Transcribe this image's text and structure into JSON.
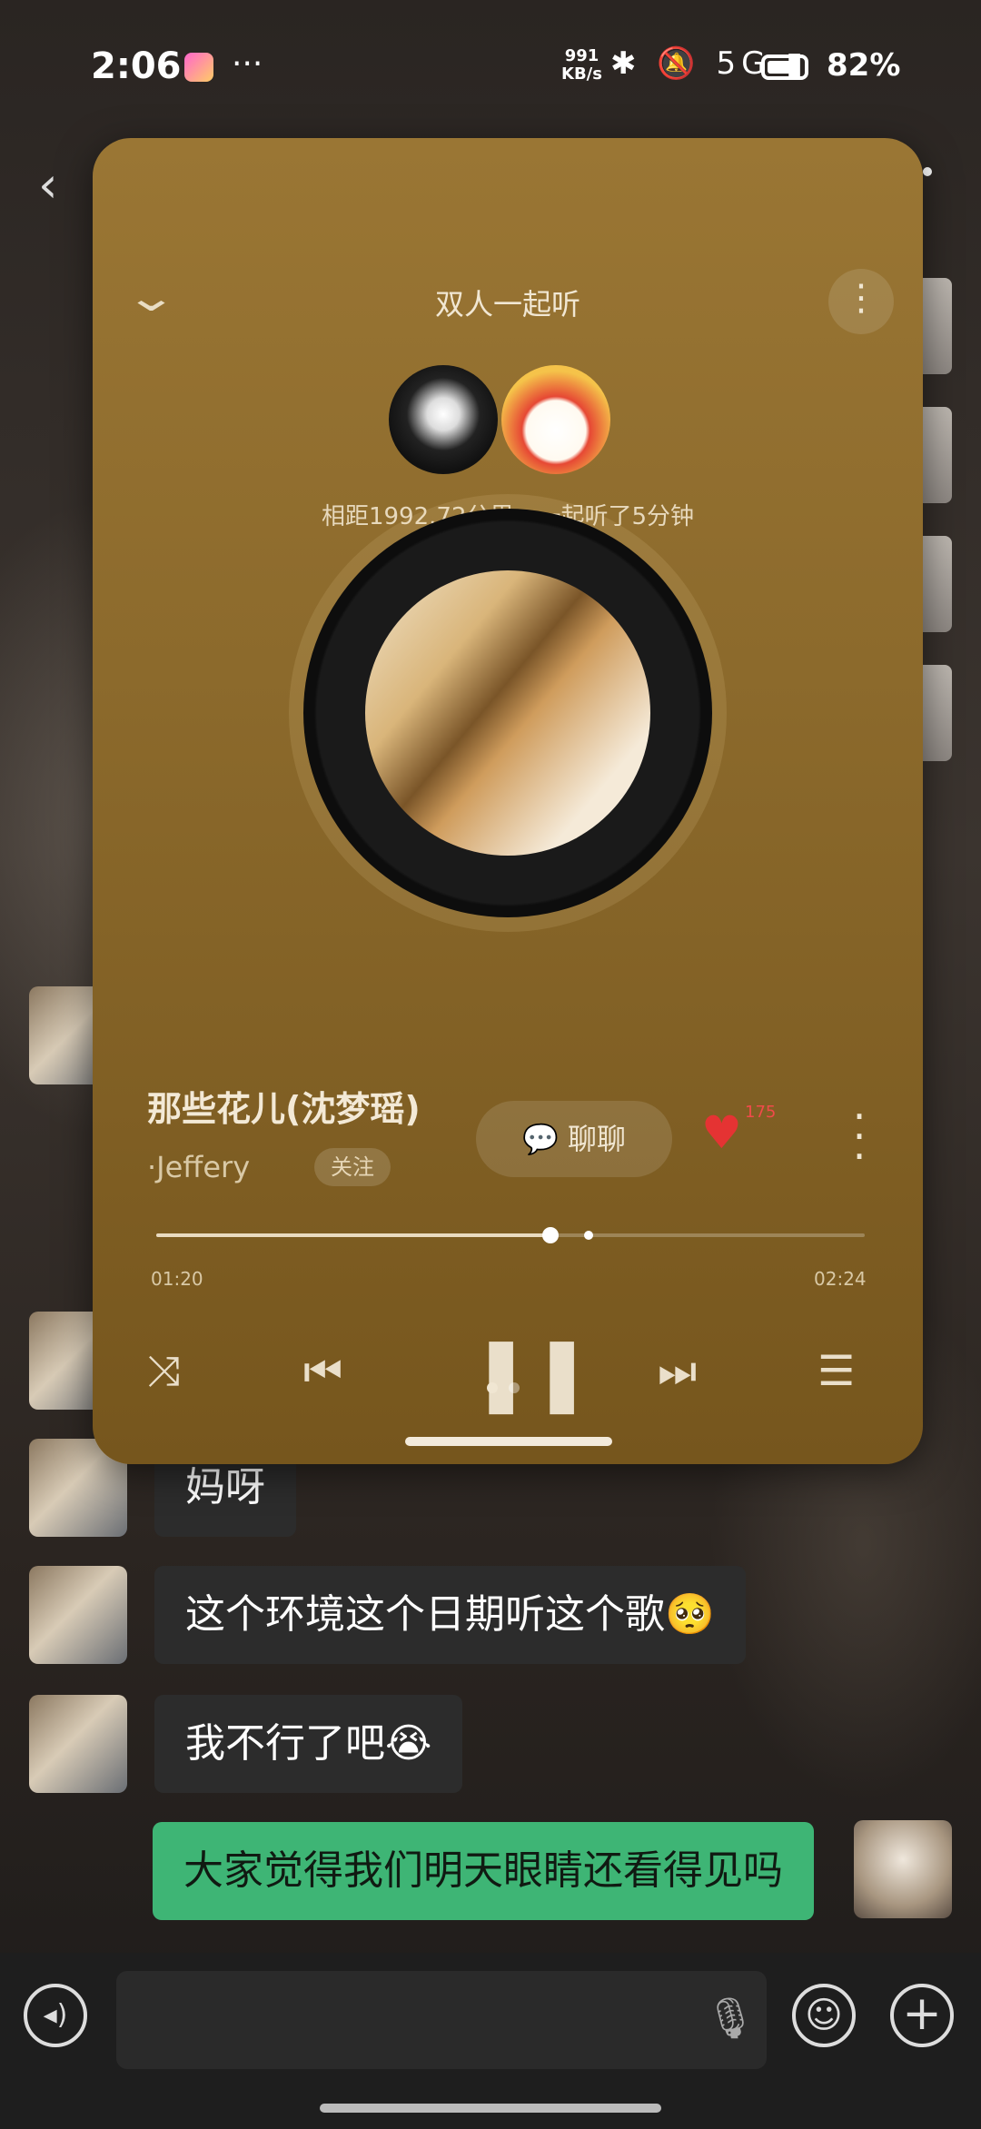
{
  "status": {
    "time": "2:06",
    "dots": "···",
    "net_speed_value": "991",
    "net_speed_unit": "KB/s",
    "icons": "✱ 🔕 5G ▮",
    "battery": "82%"
  },
  "chat": {
    "messages": [
      {
        "sender": "other",
        "text": "妈呀"
      },
      {
        "sender": "other",
        "text": "这个环境这个日期听这个歌🥺"
      },
      {
        "sender": "other",
        "text": "我不行了吧😭"
      },
      {
        "sender": "me",
        "text": "大家觉得我们明天眼睛还看得见吗"
      }
    ]
  },
  "input": {
    "placeholder": ""
  },
  "music": {
    "header_title": "双人一起听",
    "distance_text": "相距1992.72公里，一起听了5分钟",
    "song_title": "那些花儿(沈梦瑶)",
    "artist": "·Jeffery",
    "follow_label": "关注",
    "chat_label": "聊聊",
    "like_count": "175",
    "current_time": "01:20",
    "total_time": "02:24",
    "progress_fraction": 0.556,
    "buffered_fraction": 0.61,
    "page_indicator": {
      "count": 2,
      "active": 0
    }
  },
  "colors": {
    "card_accent": "#8c6a2c",
    "my_bubble": "#3eb575",
    "like": "#e53333"
  }
}
